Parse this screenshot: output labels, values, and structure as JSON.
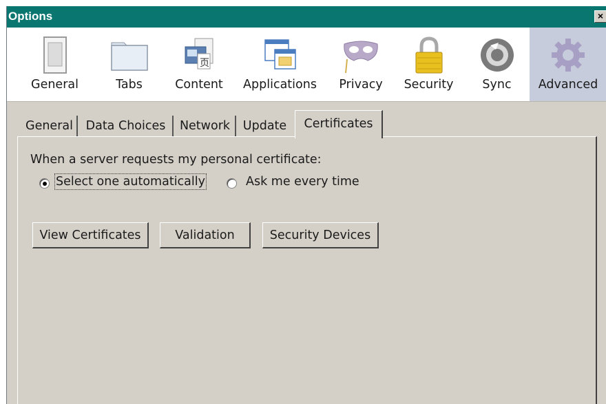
{
  "window": {
    "title": "Options",
    "close_label": "×"
  },
  "toolbar": {
    "panes": [
      {
        "label": "General",
        "icon": "window-icon"
      },
      {
        "label": "Tabs",
        "icon": "folder-tabs-icon"
      },
      {
        "label": "Content",
        "icon": "content-icon"
      },
      {
        "label": "Applications",
        "icon": "applications-icon"
      },
      {
        "label": "Privacy",
        "icon": "mask-icon"
      },
      {
        "label": "Security",
        "icon": "padlock-icon"
      },
      {
        "label": "Sync",
        "icon": "sync-icon"
      },
      {
        "label": "Advanced",
        "icon": "gear-icon",
        "selected": true
      }
    ],
    "selected_color": "#c6ccdc"
  },
  "tabs": [
    {
      "label": "General"
    },
    {
      "label": "Data Choices"
    },
    {
      "label": "Network"
    },
    {
      "label": "Update"
    },
    {
      "label": "Certificates",
      "active": true
    }
  ],
  "certificates": {
    "prompt": "When a server requests my personal certificate:",
    "options": [
      {
        "label": "Select one automatically",
        "selected": true
      },
      {
        "label": "Ask me every time",
        "selected": false
      }
    ],
    "buttons": [
      {
        "label": "View Certificates"
      },
      {
        "label": "Validation"
      },
      {
        "label": "Security Devices"
      }
    ]
  },
  "colors": {
    "titlebar": "#0a7670",
    "dialog_bg": "#d4d0c8"
  }
}
